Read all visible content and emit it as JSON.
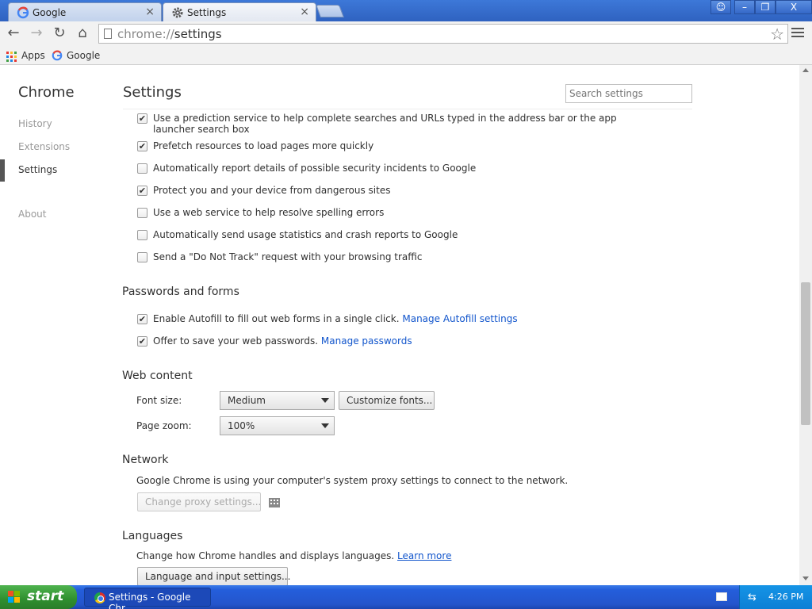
{
  "tabs": [
    {
      "title": "Google",
      "active": false
    },
    {
      "title": "Settings",
      "active": true
    }
  ],
  "window_controls": {
    "user": "☺",
    "minimize": "–",
    "restore": "❐",
    "close": "X"
  },
  "toolbar": {
    "url_scheme": "chrome://",
    "url_path": "settings",
    "back_glyph": "←",
    "forward_glyph": "→",
    "reload_glyph": "↻",
    "home_glyph": "⌂",
    "star_glyph": "☆"
  },
  "bookmarks": [
    {
      "label": "Apps"
    },
    {
      "label": "Google"
    }
  ],
  "sidebar": {
    "title": "Chrome",
    "items": [
      {
        "label": "History",
        "active": false
      },
      {
        "label": "Extensions",
        "active": false
      },
      {
        "label": "Settings",
        "active": true
      },
      {
        "label": "About",
        "active": false
      }
    ]
  },
  "main": {
    "title": "Settings",
    "search_placeholder": "Search settings",
    "privacy_options": [
      {
        "line1": "Use a prediction service to help complete searches and URLs typed in the address bar or the app",
        "line2": "launcher search box",
        "checked": true
      },
      {
        "line1": "Prefetch resources to load pages more quickly",
        "checked": true
      },
      {
        "line1": "Automatically report details of possible security incidents to Google",
        "checked": false
      },
      {
        "line1": "Protect you and your device from dangerous sites",
        "checked": true
      },
      {
        "line1": "Use a web service to help resolve spelling errors",
        "checked": false
      },
      {
        "line1": "Automatically send usage statistics and crash reports to Google",
        "checked": false
      },
      {
        "line1": "Send a \"Do Not Track\" request with your browsing traffic",
        "checked": false
      }
    ],
    "passwords": {
      "heading": "Passwords and forms",
      "autofill_text": "Enable Autofill to fill out web forms in a single click.",
      "autofill_link": "Manage Autofill settings",
      "autofill_checked": true,
      "save_pw_text": "Offer to save your web passwords.",
      "save_pw_link": "Manage passwords",
      "save_pw_checked": true
    },
    "web_content": {
      "heading": "Web content",
      "font_size_label": "Font size:",
      "font_size_value": "Medium",
      "customize_fonts": "Customize fonts...",
      "page_zoom_label": "Page zoom:",
      "page_zoom_value": "100%"
    },
    "network": {
      "heading": "Network",
      "description": "Google Chrome is using your computer's system proxy settings to connect to the network.",
      "proxy_button": "Change proxy settings..."
    },
    "languages": {
      "heading": "Languages",
      "description": "Change how Chrome handles and displays languages.",
      "learn_more": "Learn more",
      "button": "Language and input settings..."
    }
  },
  "taskbar": {
    "start_label": "start",
    "task_label": "Settings - Google Chr...",
    "clock": "4:26 PM"
  },
  "colors": {
    "link": "#1155cc",
    "tab_strip": "#3d78d8",
    "taskbar": "#245edb",
    "start": "#2f8f2f"
  }
}
